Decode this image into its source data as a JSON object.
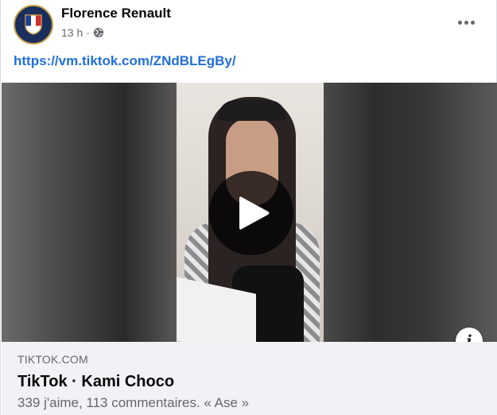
{
  "post": {
    "author": "Florence Renault",
    "time": "13 h",
    "separator": "·",
    "privacy_icon": "globe-icon",
    "more_icon": "more-horizontal-icon",
    "link_text": "https://vm.tiktok.com/ZNdBLEgBy/"
  },
  "media": {
    "play_icon": "play-icon",
    "info_icon": "info-icon",
    "info_glyph": "i"
  },
  "preview": {
    "domain": "TIKTOK.COM",
    "title": "TikTok · Kami Choco",
    "description": "339 j'aime, 113 commentaires. « Ase »"
  },
  "colors": {
    "link": "#216fdb",
    "secondary_text": "#65676b",
    "preview_bg": "#f0f2f5"
  }
}
